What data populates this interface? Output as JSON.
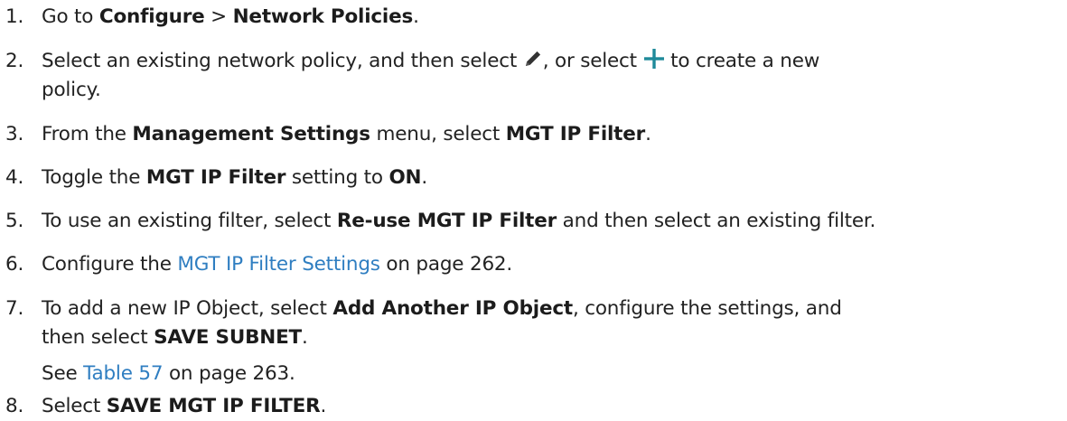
{
  "steps": [
    {
      "number": "1.",
      "parts": [
        "Go to ",
        "Configure",
        " > ",
        "Network Policies",
        "."
      ]
    },
    {
      "number": "2.",
      "line1_a": "Select an existing network policy, and then select ",
      "icon_edit": "pencil-icon",
      "line1_b": ", or select ",
      "icon_add": "plus-icon",
      "line1_c": " to create a new",
      "line2": "policy."
    },
    {
      "number": "3.",
      "parts": [
        "From the ",
        "Management Settings",
        " menu, select ",
        "MGT IP Filter",
        "."
      ]
    },
    {
      "number": "4.",
      "parts": [
        "Toggle the ",
        "MGT IP Filter",
        " setting to ",
        "ON",
        "."
      ]
    },
    {
      "number": "5.",
      "parts": [
        "To use an existing filter, select ",
        "Re-use MGT IP Filter",
        " and then select an existing filter."
      ]
    },
    {
      "number": "6.",
      "parts": [
        "Configure the ",
        "MGT IP Filter Settings",
        " on page 262."
      ]
    },
    {
      "number": "7.",
      "line1": [
        "To add a new IP Object, select ",
        "Add Another IP Object",
        ", configure the settings, and"
      ],
      "line2": [
        "then select ",
        "SAVE SUBNET",
        "."
      ],
      "note": [
        "See ",
        "Table 57",
        " on page 263."
      ]
    },
    {
      "number": "8.",
      "parts": [
        "Select ",
        "SAVE MGT IP FILTER",
        "."
      ]
    }
  ],
  "colors": {
    "text": "#222222",
    "link": "#2f7ec1",
    "icon_edit": "#333333",
    "icon_add": "#1f8a9a"
  }
}
